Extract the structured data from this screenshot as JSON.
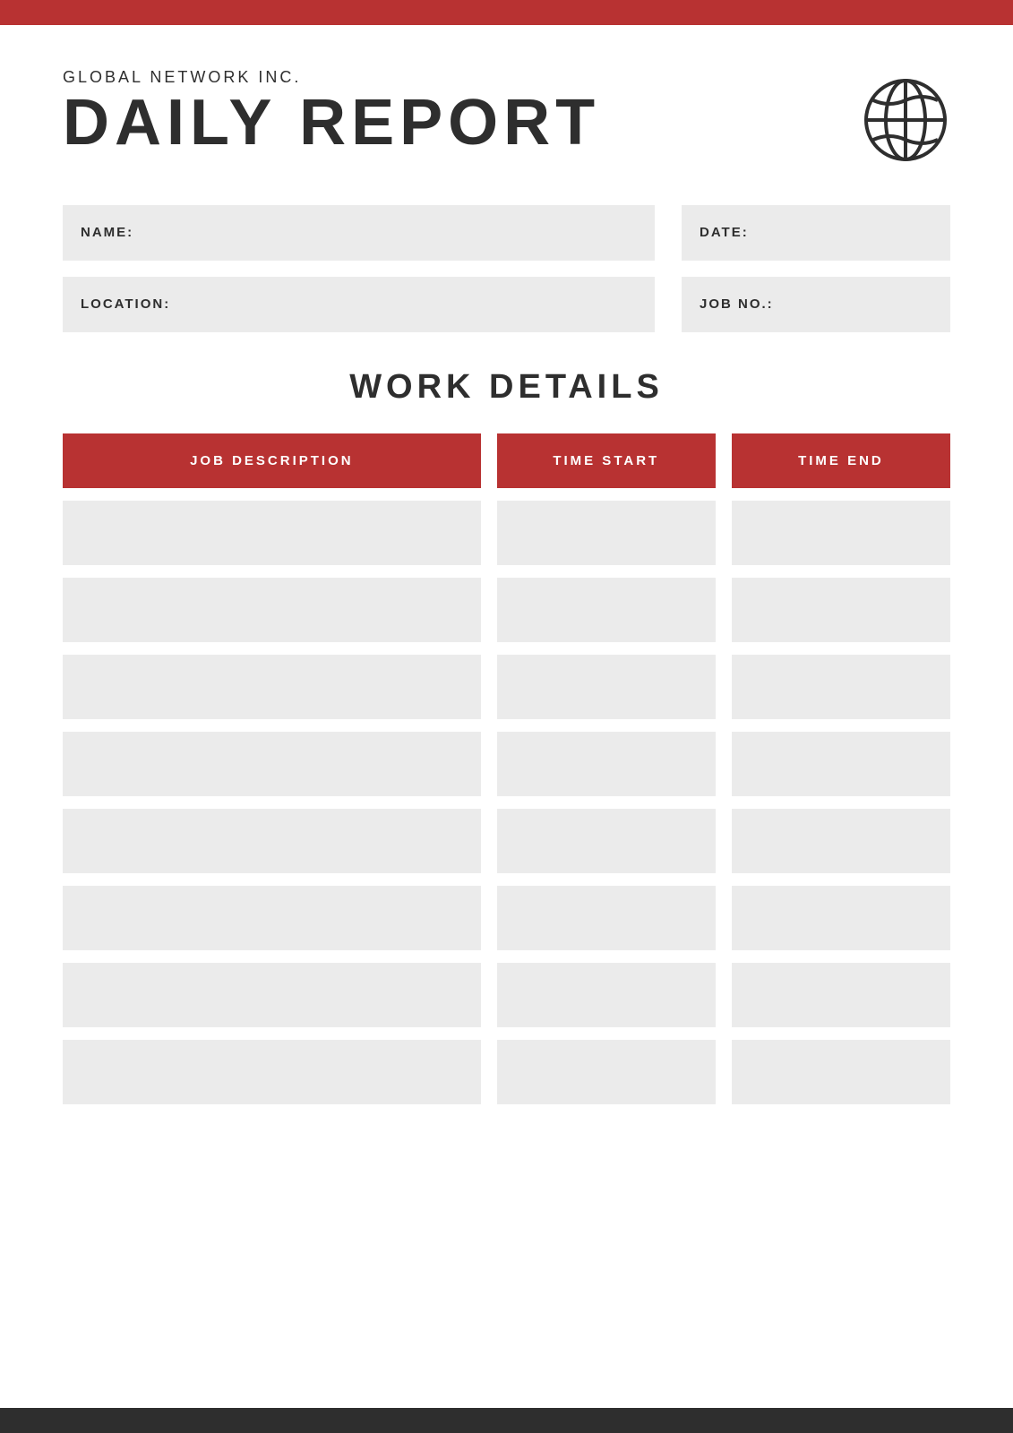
{
  "topBar": {
    "color": "#b83232"
  },
  "bottomBar": {
    "color": "#2e2e2e"
  },
  "header": {
    "companyName": "GLOBAL NETWORK INC.",
    "reportTitle": "DAILY REPORT",
    "globeIcon": "globe-icon"
  },
  "form": {
    "fields": [
      {
        "label": "NAME:",
        "short": false
      },
      {
        "label": "DATE:",
        "short": true
      }
    ],
    "fields2": [
      {
        "label": "LOCATION:",
        "short": false
      },
      {
        "label": "JOB NO.:",
        "short": true
      }
    ]
  },
  "workDetails": {
    "sectionTitle": "WORK DETAILS",
    "columns": {
      "jobDescription": "JOB DESCRIPTION",
      "timeStart": "TIME START",
      "timeEnd": "TIME END"
    },
    "rowCount": 8
  }
}
